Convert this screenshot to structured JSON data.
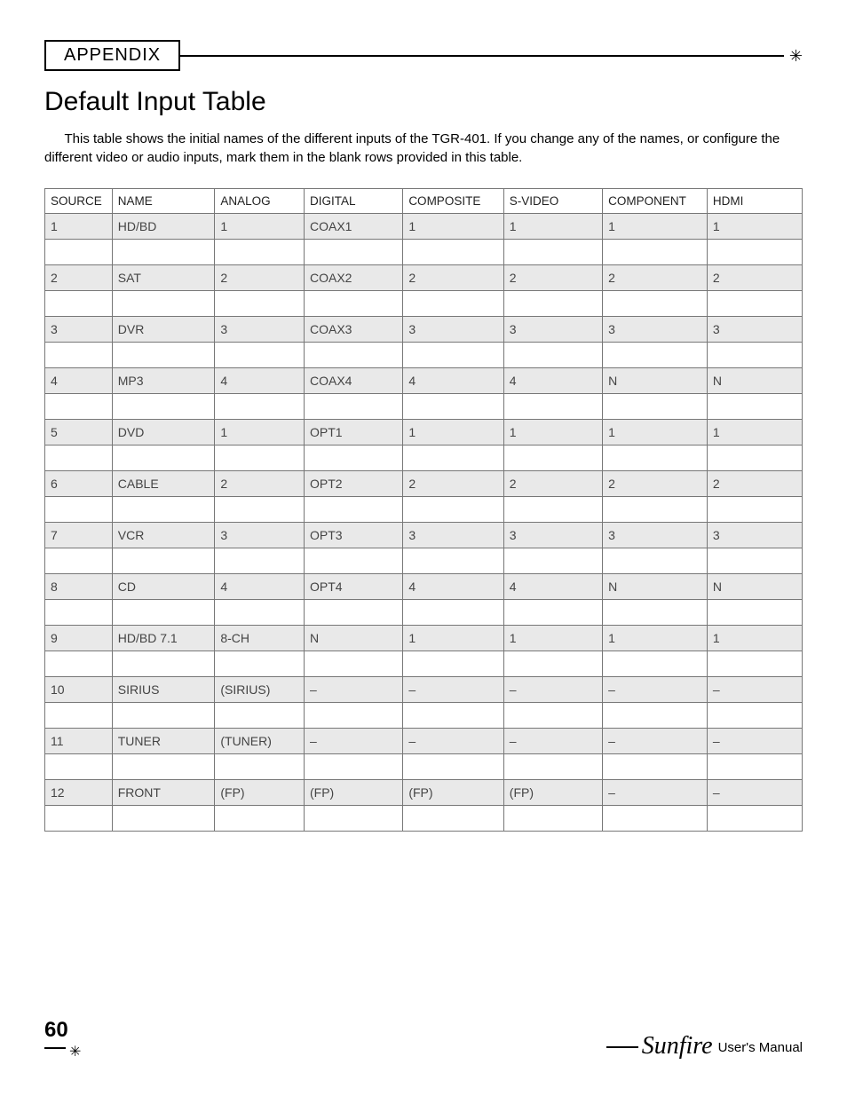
{
  "header": {
    "section": "APPENDIX",
    "star": "✳"
  },
  "title": "Default Input Table",
  "intro": "This table shows the initial names of the different inputs of the TGR-401. If you change any of the names, or configure the different video or audio inputs, mark them in the blank rows provided in this table.",
  "columns": [
    "SOURCE",
    "NAME",
    "ANALOG",
    "DIGITAL",
    "COMPOSITE",
    "S-VIDEO",
    "COMPONENT",
    "HDMI"
  ],
  "rows": [
    {
      "source": "1",
      "name": "HD/BD",
      "analog": "1",
      "digital": "COAX1",
      "composite": "1",
      "svideo": "1",
      "component": "1",
      "hdmi": "1"
    },
    {
      "source": "2",
      "name": "SAT",
      "analog": "2",
      "digital": "COAX2",
      "composite": "2",
      "svideo": "2",
      "component": "2",
      "hdmi": "2"
    },
    {
      "source": "3",
      "name": "DVR",
      "analog": "3",
      "digital": "COAX3",
      "composite": "3",
      "svideo": "3",
      "component": "3",
      "hdmi": "3"
    },
    {
      "source": "4",
      "name": "MP3",
      "analog": "4",
      "digital": "COAX4",
      "composite": "4",
      "svideo": "4",
      "component": "N",
      "hdmi": "N"
    },
    {
      "source": "5",
      "name": "DVD",
      "analog": "1",
      "digital": "OPT1",
      "composite": "1",
      "svideo": "1",
      "component": "1",
      "hdmi": "1"
    },
    {
      "source": "6",
      "name": "CABLE",
      "analog": "2",
      "digital": "OPT2",
      "composite": "2",
      "svideo": "2",
      "component": "2",
      "hdmi": "2"
    },
    {
      "source": "7",
      "name": "VCR",
      "analog": "3",
      "digital": "OPT3",
      "composite": "3",
      "svideo": "3",
      "component": "3",
      "hdmi": "3"
    },
    {
      "source": "8",
      "name": "CD",
      "analog": "4",
      "digital": "OPT4",
      "composite": "4",
      "svideo": "4",
      "component": "N",
      "hdmi": "N"
    },
    {
      "source": "9",
      "name": "HD/BD 7.1",
      "analog": "8-CH",
      "digital": "N",
      "composite": "1",
      "svideo": "1",
      "component": "1",
      "hdmi": "1"
    },
    {
      "source": "10",
      "name": "SIRIUS",
      "analog": "(SIRIUS)",
      "digital": "–",
      "composite": "–",
      "svideo": "–",
      "component": "–",
      "hdmi": "–"
    },
    {
      "source": "11",
      "name": "TUNER",
      "analog": "(TUNER)",
      "digital": "–",
      "composite": "–",
      "svideo": "–",
      "component": "–",
      "hdmi": "–"
    },
    {
      "source": "12",
      "name": "FRONT",
      "analog": "(FP)",
      "digital": "(FP)",
      "composite": "(FP)",
      "svideo": "(FP)",
      "component": "–",
      "hdmi": "–"
    }
  ],
  "footer": {
    "page": "60",
    "star": "✳",
    "brand": "Sunfire",
    "manual": "User's Manual"
  }
}
